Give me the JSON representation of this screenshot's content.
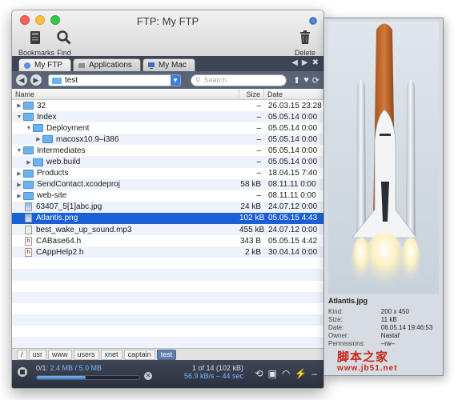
{
  "window": {
    "title": "FTP: My FTP",
    "toolbar": {
      "bookmarks": "Bookmarks",
      "find": "Find",
      "delete": "Delete"
    }
  },
  "tabs": [
    {
      "label": "My FTP",
      "active": true
    },
    {
      "label": "Applications",
      "active": false
    },
    {
      "label": "My Mac",
      "active": false
    }
  ],
  "pathbar": {
    "folder": "test",
    "search_placeholder": "Search"
  },
  "columns": {
    "name": "Name",
    "size": "Size",
    "date": "Date"
  },
  "files": [
    {
      "indent": 0,
      "disc": "▶",
      "type": "folder",
      "name": "32",
      "size": "–",
      "date": "26.03.15 23:28"
    },
    {
      "indent": 0,
      "disc": "▼",
      "type": "folder",
      "name": "Index",
      "size": "–",
      "date": "05.05.14 0:00"
    },
    {
      "indent": 1,
      "disc": "▼",
      "type": "folder",
      "name": "Deployment",
      "size": "–",
      "date": "05.05.14 0:00"
    },
    {
      "indent": 2,
      "disc": "▶",
      "type": "folder",
      "name": "macosx10.9–i386",
      "size": "–",
      "date": "05.05.14 0:00"
    },
    {
      "indent": 0,
      "disc": "▼",
      "type": "folder",
      "name": "Intermediates",
      "size": "–",
      "date": "05.05.14 0:00"
    },
    {
      "indent": 1,
      "disc": "▶",
      "type": "folder",
      "name": "web.build",
      "size": "–",
      "date": "05.05.14 0:00"
    },
    {
      "indent": 0,
      "disc": "▶",
      "type": "folder",
      "name": "Products",
      "size": "–",
      "date": "18.04.15 7:40"
    },
    {
      "indent": 0,
      "disc": "▶",
      "type": "folder",
      "name": "SendContact.xcodeproj",
      "size": "58 kB",
      "date": "08.11.11 0:00"
    },
    {
      "indent": 0,
      "disc": "▶",
      "type": "folder",
      "name": "web-site",
      "size": "–",
      "date": "08.11.11 0:00"
    },
    {
      "indent": 0,
      "disc": "",
      "type": "img",
      "name": "63407_5[1]abc.jpg",
      "size": "24 kB",
      "date": "24.07.12 0:00"
    },
    {
      "indent": 0,
      "disc": "",
      "type": "img",
      "name": "Atlantis.png",
      "size": "102 kB",
      "date": "05.05.15 4:43",
      "selected": true
    },
    {
      "indent": 0,
      "disc": "",
      "type": "mp3",
      "name": "best_wake_up_sound.mp3",
      "size": "455 kB",
      "date": "24.07.12 0:00"
    },
    {
      "indent": 0,
      "disc": "",
      "type": "h",
      "name": "CABase64.h",
      "size": "343 B",
      "date": "05.05.15 4:42"
    },
    {
      "indent": 0,
      "disc": "",
      "type": "h",
      "name": "CAppHelp2.h",
      "size": "2 kB",
      "date": "30.04.14 0:00"
    }
  ],
  "breadcrumbs": [
    "/",
    "usr",
    "www",
    "users",
    "xnet",
    "captain",
    "test"
  ],
  "status": {
    "transfer_prefix": "0/1:",
    "transfer_amount": "2.4 MB / 5.0 MB",
    "progress": 0.48,
    "count": "1 of 14 (102 kB)",
    "speed": "56.9 kB/s – 44 sec"
  },
  "preview": {
    "filename": "Atlantis.jpg",
    "rows": [
      {
        "key": "Kind:",
        "value": "200 x 450"
      },
      {
        "key": "Size:",
        "value": "11 kB"
      },
      {
        "key": "Date:",
        "value": "06.05.14 19:46:53"
      },
      {
        "key": "Owner:",
        "value": "Nastaf"
      },
      {
        "key": "Permissions:",
        "value": "–rw–"
      }
    ],
    "watermark": "脚本之家",
    "watermark_url": "www.jb51.net"
  },
  "colors": {
    "selection": "#1a5fd6",
    "status_bg": "#2b303d",
    "folder": "#6cb2ec"
  }
}
